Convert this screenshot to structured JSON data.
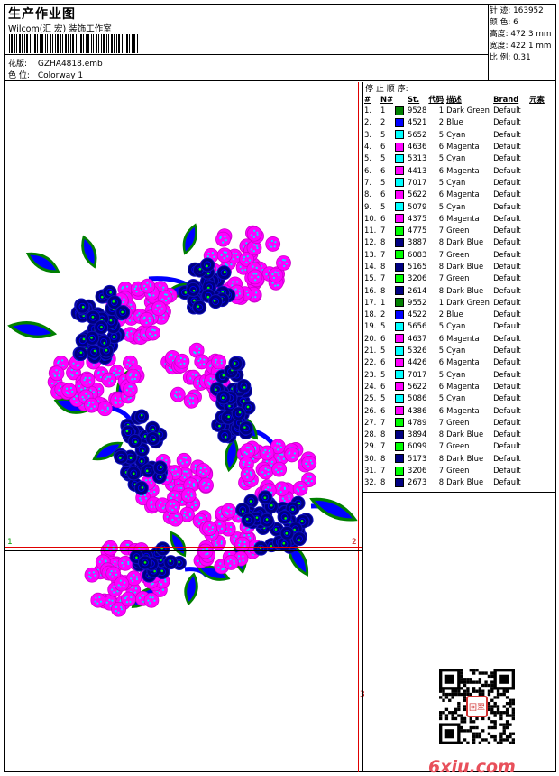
{
  "header": {
    "title": "生产作业图",
    "company": "Wilcom(汇 宏) 装饰工作室",
    "design_label": "花版:",
    "design_value": "GZHA4818.emb",
    "colorway_label": "色 位:",
    "colorway_value": "Colorway 1"
  },
  "stats": [
    {
      "label": "针 迹:",
      "value": "163952"
    },
    {
      "label": "颜 色:",
      "value": "6"
    },
    {
      "label": "高度:",
      "value": "472.3 mm"
    },
    {
      "label": "宽度:",
      "value": "422.1 mm"
    },
    {
      "label": "比 例:",
      "value": "0.31"
    }
  ],
  "sequence": {
    "title": "停 止 顺 序:",
    "headers": {
      "idx": "#",
      "n": "N#",
      "st": "St.",
      "code": "代码",
      "desc": "描述",
      "brand": "Brand",
      "element": "元素"
    },
    "rows": [
      {
        "idx": "1.",
        "n": "1",
        "color": "#008000",
        "st": "9528",
        "code": "1",
        "desc": "Dark Green",
        "brand": "Default"
      },
      {
        "idx": "2.",
        "n": "2",
        "color": "#0000ff",
        "st": "4521",
        "code": "2",
        "desc": "Blue",
        "brand": "Default"
      },
      {
        "idx": "3.",
        "n": "5",
        "color": "#00ffff",
        "st": "5652",
        "code": "5",
        "desc": "Cyan",
        "brand": "Default"
      },
      {
        "idx": "4.",
        "n": "6",
        "color": "#ff00ff",
        "st": "4636",
        "code": "6",
        "desc": "Magenta",
        "brand": "Default"
      },
      {
        "idx": "5.",
        "n": "5",
        "color": "#00ffff",
        "st": "5313",
        "code": "5",
        "desc": "Cyan",
        "brand": "Default"
      },
      {
        "idx": "6.",
        "n": "6",
        "color": "#ff00ff",
        "st": "4413",
        "code": "6",
        "desc": "Magenta",
        "brand": "Default"
      },
      {
        "idx": "7.",
        "n": "5",
        "color": "#00ffff",
        "st": "7017",
        "code": "5",
        "desc": "Cyan",
        "brand": "Default"
      },
      {
        "idx": "8.",
        "n": "6",
        "color": "#ff00ff",
        "st": "5622",
        "code": "6",
        "desc": "Magenta",
        "brand": "Default"
      },
      {
        "idx": "9.",
        "n": "5",
        "color": "#00ffff",
        "st": "5079",
        "code": "5",
        "desc": "Cyan",
        "brand": "Default"
      },
      {
        "idx": "10.",
        "n": "6",
        "color": "#ff00ff",
        "st": "4375",
        "code": "6",
        "desc": "Magenta",
        "brand": "Default"
      },
      {
        "idx": "11.",
        "n": "7",
        "color": "#00ff00",
        "st": "4775",
        "code": "7",
        "desc": "Green",
        "brand": "Default"
      },
      {
        "idx": "12.",
        "n": "8",
        "color": "#000080",
        "st": "3887",
        "code": "8",
        "desc": "Dark Blue",
        "brand": "Default"
      },
      {
        "idx": "13.",
        "n": "7",
        "color": "#00ff00",
        "st": "6083",
        "code": "7",
        "desc": "Green",
        "brand": "Default"
      },
      {
        "idx": "14.",
        "n": "8",
        "color": "#000080",
        "st": "5165",
        "code": "8",
        "desc": "Dark Blue",
        "brand": "Default"
      },
      {
        "idx": "15.",
        "n": "7",
        "color": "#00ff00",
        "st": "3206",
        "code": "7",
        "desc": "Green",
        "brand": "Default"
      },
      {
        "idx": "16.",
        "n": "8",
        "color": "#000080",
        "st": "2614",
        "code": "8",
        "desc": "Dark Blue",
        "brand": "Default"
      },
      {
        "idx": "17.",
        "n": "1",
        "color": "#008000",
        "st": "9552",
        "code": "1",
        "desc": "Dark Green",
        "brand": "Default"
      },
      {
        "idx": "18.",
        "n": "2",
        "color": "#0000ff",
        "st": "4522",
        "code": "2",
        "desc": "Blue",
        "brand": "Default"
      },
      {
        "idx": "19.",
        "n": "5",
        "color": "#00ffff",
        "st": "5656",
        "code": "5",
        "desc": "Cyan",
        "brand": "Default"
      },
      {
        "idx": "20.",
        "n": "6",
        "color": "#ff00ff",
        "st": "4637",
        "code": "6",
        "desc": "Magenta",
        "brand": "Default"
      },
      {
        "idx": "21.",
        "n": "5",
        "color": "#00ffff",
        "st": "5326",
        "code": "5",
        "desc": "Cyan",
        "brand": "Default"
      },
      {
        "idx": "22.",
        "n": "6",
        "color": "#ff00ff",
        "st": "4426",
        "code": "6",
        "desc": "Magenta",
        "brand": "Default"
      },
      {
        "idx": "23.",
        "n": "5",
        "color": "#00ffff",
        "st": "7017",
        "code": "5",
        "desc": "Cyan",
        "brand": "Default"
      },
      {
        "idx": "24.",
        "n": "6",
        "color": "#ff00ff",
        "st": "5622",
        "code": "6",
        "desc": "Magenta",
        "brand": "Default"
      },
      {
        "idx": "25.",
        "n": "5",
        "color": "#00ffff",
        "st": "5086",
        "code": "5",
        "desc": "Cyan",
        "brand": "Default"
      },
      {
        "idx": "26.",
        "n": "6",
        "color": "#ff00ff",
        "st": "4386",
        "code": "6",
        "desc": "Magenta",
        "brand": "Default"
      },
      {
        "idx": "27.",
        "n": "7",
        "color": "#00ff00",
        "st": "4789",
        "code": "7",
        "desc": "Green",
        "brand": "Default"
      },
      {
        "idx": "28.",
        "n": "8",
        "color": "#000080",
        "st": "3894",
        "code": "8",
        "desc": "Dark Blue",
        "brand": "Default"
      },
      {
        "idx": "29.",
        "n": "7",
        "color": "#00ff00",
        "st": "6099",
        "code": "7",
        "desc": "Green",
        "brand": "Default"
      },
      {
        "idx": "30.",
        "n": "8",
        "color": "#000080",
        "st": "5173",
        "code": "8",
        "desc": "Dark Blue",
        "brand": "Default"
      },
      {
        "idx": "31.",
        "n": "7",
        "color": "#00ff00",
        "st": "3206",
        "code": "7",
        "desc": "Green",
        "brand": "Default"
      },
      {
        "idx": "32.",
        "n": "8",
        "color": "#000080",
        "st": "2673",
        "code": "8",
        "desc": "Dark Blue",
        "brand": "Default"
      }
    ]
  },
  "design": {
    "colors": {
      "magenta": "#ff00ff",
      "cyan": "#00e5ff",
      "dark_blue": "#000080",
      "blue": "#0000ff",
      "dark_green": "#008000",
      "green": "#00ff00"
    },
    "markers": {
      "left": "1",
      "right": "2",
      "bottom": "3"
    }
  },
  "watermark": "6xiu.com",
  "qr_seal": "回翠"
}
